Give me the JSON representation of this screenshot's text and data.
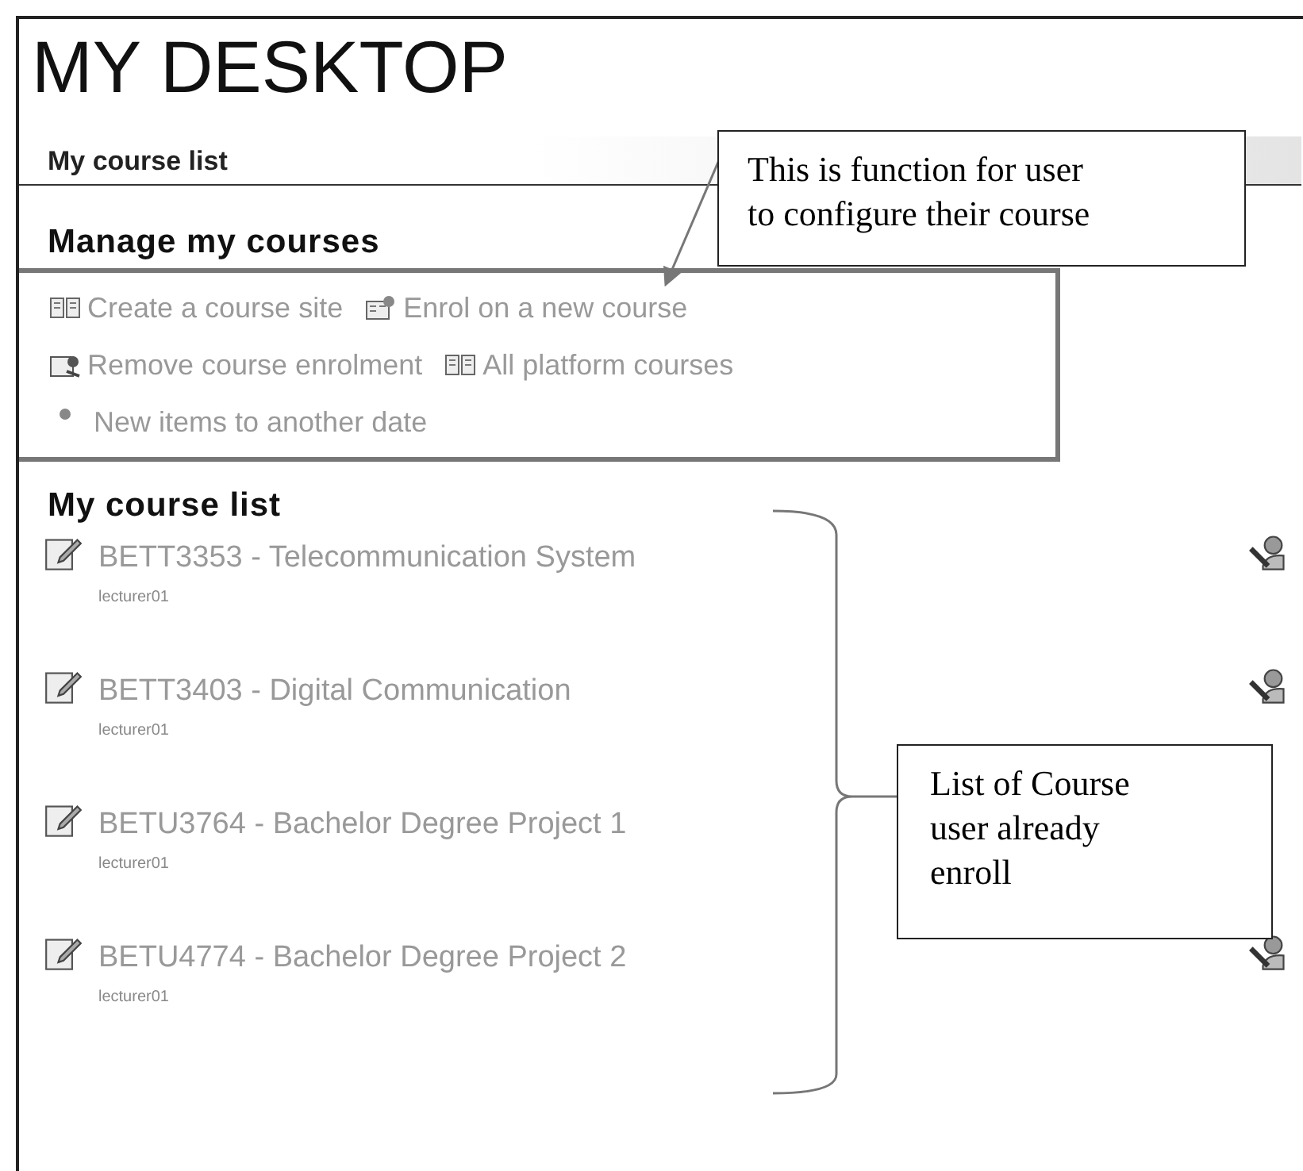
{
  "page": {
    "title": "MY DESKTOP"
  },
  "section_bar": {
    "label": "My course list"
  },
  "manage": {
    "heading": "Manage my courses",
    "link_rows": [
      {
        "links": [
          {
            "kind": "create",
            "label": "Create a course site"
          },
          {
            "kind": "enrol",
            "label": "Enrol on a new course"
          }
        ]
      },
      {
        "links": [
          {
            "kind": "remove",
            "label": "Remove course enrolment"
          },
          {
            "kind": "catalog",
            "label": "All platform courses"
          }
        ]
      },
      {
        "links": [
          {
            "kind": "bullet",
            "label": "New items to another date"
          }
        ]
      }
    ]
  },
  "courses": {
    "heading": "My course list",
    "items": [
      {
        "title": "BETT3353 - Telecommunication System",
        "teacher": "lecturer01",
        "action_icon": true
      },
      {
        "title": "BETT3403 - Digital Communication",
        "teacher": "lecturer01",
        "action_icon": true
      },
      {
        "title": "BETU3764 - Bachelor Degree Project 1",
        "teacher": "lecturer01",
        "action_icon": false
      },
      {
        "title": "BETU4774 - Bachelor Degree Project 2",
        "teacher": "lecturer01",
        "action_icon": true
      }
    ]
  },
  "annotations": [
    {
      "kind": "arrow",
      "text": "This is function for user\nto configure their course"
    },
    {
      "kind": "brace",
      "text": "List of Course\nuser already\nenroll"
    }
  ]
}
